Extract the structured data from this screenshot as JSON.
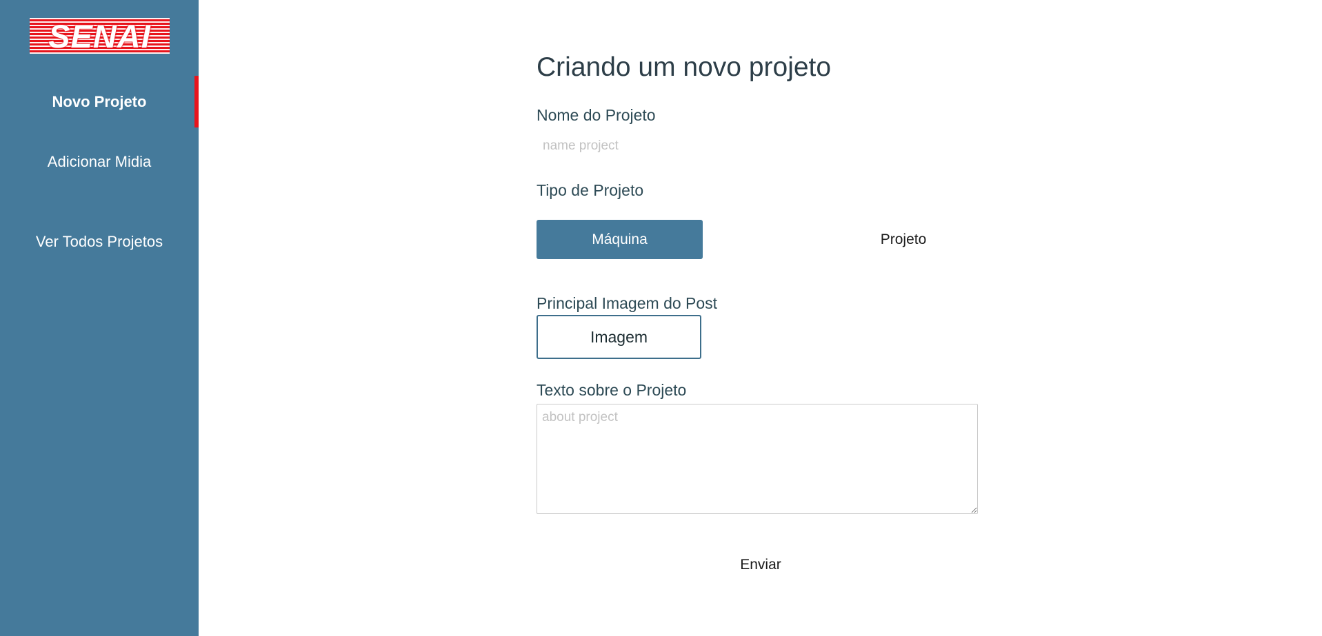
{
  "brand": {
    "logo_text": "SENAI",
    "color": "#e8141c"
  },
  "sidebar": {
    "background": "#457a9b",
    "items": [
      {
        "label": "Novo Projeto",
        "active": true
      },
      {
        "label": "Adicionar Midia",
        "active": false
      },
      {
        "label": "Ver Todos Projetos",
        "active": false
      }
    ]
  },
  "form": {
    "title": "Criando um novo projeto",
    "name_label": "Nome do Projeto",
    "name_placeholder": "name project",
    "type_label": "Tipo de Projeto",
    "type_options": [
      {
        "label": "Máquina",
        "selected": true
      },
      {
        "label": "Projeto",
        "selected": false
      }
    ],
    "image_label": "Principal Imagem do Post",
    "image_button": "Imagem",
    "text_label": "Texto sobre o Projeto",
    "text_placeholder": "about project",
    "submit_label": "Enviar"
  }
}
